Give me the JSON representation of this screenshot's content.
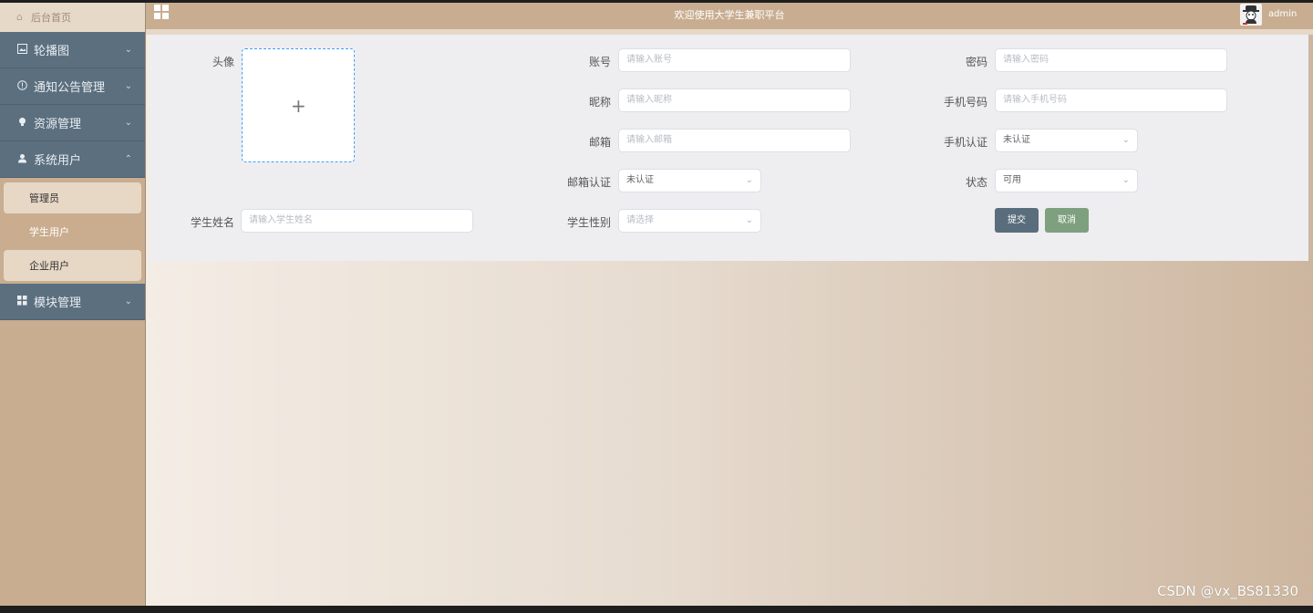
{
  "sidebar": {
    "home_label": "后台首页",
    "menus": [
      {
        "label": "轮播图",
        "icon": "image-icon",
        "chev": "⌄"
      },
      {
        "label": "通知公告管理",
        "icon": "info-icon",
        "chev": "⌄"
      },
      {
        "label": "资源管理",
        "icon": "bulb-icon",
        "chev": "⌄"
      },
      {
        "label": "系统用户",
        "icon": "user-icon",
        "chev": "⌃"
      },
      {
        "label": "模块管理",
        "icon": "grid-icon",
        "chev": "⌄"
      }
    ],
    "sub_items": [
      "管理员",
      "学生用户",
      "企业用户"
    ],
    "active_sub": "学生用户"
  },
  "header": {
    "title": "欢迎使用大学生兼职平台",
    "user": "admin"
  },
  "form": {
    "avatar_label": "头像",
    "account_label": "账号",
    "account_placeholder": "请输入账号",
    "password_label": "密码",
    "password_placeholder": "请输入密码",
    "nickname_label": "昵称",
    "nickname_placeholder": "请输入昵称",
    "phone_label": "手机号码",
    "phone_placeholder": "请输入手机号码",
    "email_label": "邮箱",
    "email_placeholder": "请输入邮箱",
    "phone_verify_label": "手机认证",
    "phone_verify_value": "未认证",
    "email_verify_label": "邮箱认证",
    "email_verify_value": "未认证",
    "status_label": "状态",
    "status_value": "可用",
    "student_name_label": "学生姓名",
    "student_name_placeholder": "请输入学生姓名",
    "gender_label": "学生性别",
    "gender_placeholder": "请选择",
    "submit_label": "提交",
    "cancel_label": "取消"
  },
  "watermark": "CSDN @vx_BS81330",
  "colors": {
    "sidebar_menu": "#5b6f7f",
    "topbar": "#c9ad91",
    "submit": "#5a6d7d",
    "cancel": "#7fa07f",
    "upload_border": "#409eff"
  }
}
